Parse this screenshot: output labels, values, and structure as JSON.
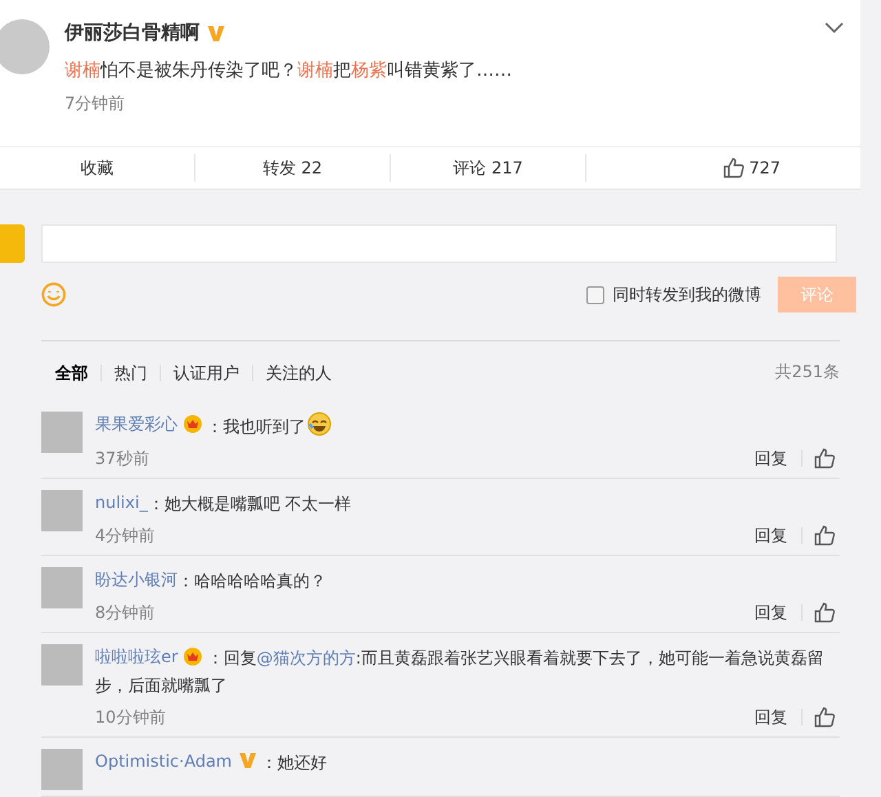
{
  "post": {
    "author": "伊丽莎白骨精啊",
    "verified": true,
    "segments": [
      {
        "text": "谢楠",
        "highlight": true
      },
      {
        "text": "怕不是被朱丹传染了吧？",
        "highlight": false
      },
      {
        "text": "谢楠",
        "highlight": true
      },
      {
        "text": "把",
        "highlight": false
      },
      {
        "text": "杨紫",
        "highlight": true
      },
      {
        "text": "叫错黄紫了……",
        "highlight": false
      }
    ],
    "time": "7分钟前",
    "actions": [
      {
        "kind": "text",
        "label": "收藏"
      },
      {
        "kind": "text",
        "label": "转发 22"
      },
      {
        "kind": "text",
        "label": "评论 217"
      },
      {
        "kind": "like",
        "label": "727"
      }
    ]
  },
  "composer": {
    "checkbox": {
      "label": "同时转发到我的微博",
      "checked": false
    },
    "submit": {
      "label": "评论",
      "disabled": true
    }
  },
  "filters": {
    "tabs": [
      {
        "label": "全部",
        "selected": true
      },
      {
        "label": "热门",
        "selected": false
      },
      {
        "label": "认证用户",
        "selected": false
      },
      {
        "label": "关注的人",
        "selected": false
      }
    ],
    "count": "共251条"
  },
  "comments": [
    {
      "user": "果果爱彩心",
      "vip": true,
      "verified": false,
      "segments": [
        {
          "text": "：我也听到了",
          "highlight": false
        }
      ],
      "emoji": true,
      "time": "37秒前",
      "reply": "回复"
    },
    {
      "user": "nulixi_",
      "vip": false,
      "verified": false,
      "segments": [
        {
          "text": "：她大概是嘴瓢吧 不太一样",
          "highlight": false
        }
      ],
      "emoji": false,
      "time": "4分钟前",
      "reply": "回复"
    },
    {
      "user": "盼达小银河",
      "vip": false,
      "verified": false,
      "segments": [
        {
          "text": "：哈哈哈哈哈真的？",
          "highlight": false
        }
      ],
      "emoji": false,
      "time": "8分钟前",
      "reply": "回复"
    },
    {
      "user": "啦啦啦玹er",
      "vip": true,
      "verified": false,
      "segments": [
        {
          "text": "：回复",
          "highlight": false
        },
        {
          "text": "@猫次方的方",
          "highlight": true
        },
        {
          "text": ":而且黄磊跟着张艺兴眼看着就要下去了，她可能一着急说黄磊留步，后面就嘴瓢了",
          "highlight": false
        }
      ],
      "emoji": false,
      "time": "10分钟前",
      "reply": "回复"
    },
    {
      "user": "Optimistic·Adam",
      "vip": false,
      "verified": true,
      "segments": [
        {
          "text": "：她还好",
          "highlight": false
        }
      ],
      "emoji": false
    }
  ]
}
